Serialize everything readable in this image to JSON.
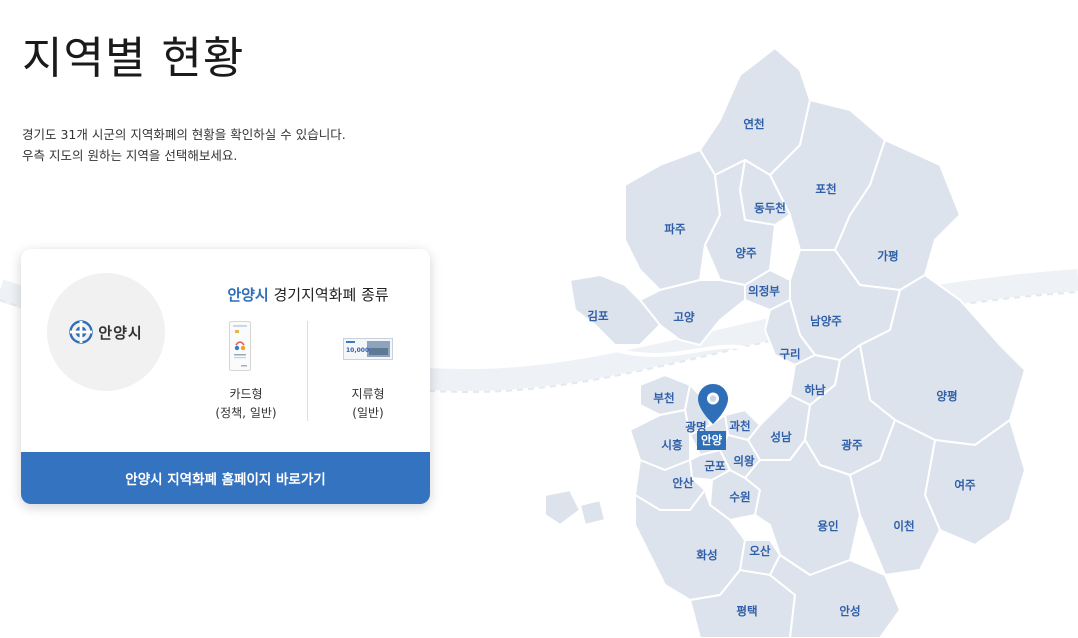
{
  "page": {
    "title": "지역별 현황",
    "description_line1": "경기도 31개 시군의 지역화폐의 현황을 확인하실 수 있습니다.",
    "description_line2": "우측 지도의 원하는 지역을 선택해보세요."
  },
  "card": {
    "logo_text": "안양시",
    "heading_city": "안양시",
    "heading_rest": " 경기지역화폐 종류",
    "types": [
      {
        "label": "카드형",
        "sub": "(정책, 일반)"
      },
      {
        "label": "지류형",
        "sub": "(일반)"
      }
    ],
    "voucher_amount": "10,000",
    "button_label": "안양시 지역화폐 홈페이지 바로가기"
  },
  "map": {
    "selected": "안양",
    "regions": [
      "연천",
      "포천",
      "동두천",
      "파주",
      "양주",
      "가평",
      "김포",
      "고양",
      "의정부",
      "남양주",
      "구리",
      "하남",
      "부천",
      "광명",
      "과천",
      "시흥",
      "성남",
      "광주",
      "양평",
      "군포",
      "의왕",
      "안산",
      "수원",
      "여주",
      "용인",
      "이천",
      "화성",
      "오산",
      "평택",
      "안성"
    ]
  },
  "colors": {
    "accent": "#3373c0",
    "region_fill": "#dde3ec",
    "region_label": "#2f5fa8",
    "pin": "#2f6fb8"
  }
}
